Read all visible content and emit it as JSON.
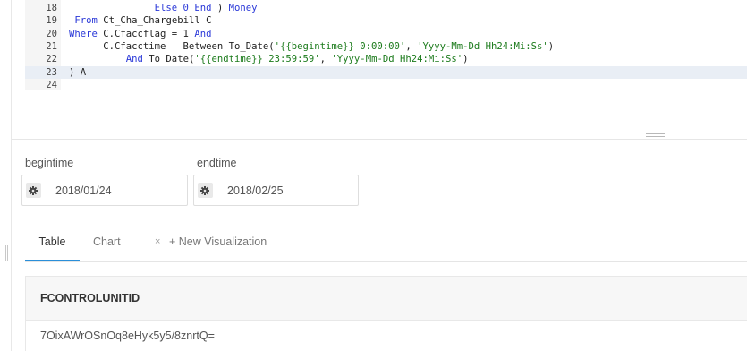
{
  "editor": {
    "lines": [
      {
        "num": "18",
        "active": false,
        "parts": [
          {
            "t": "               "
          },
          {
            "t": "Else 0 End",
            "c": "kw"
          },
          {
            "t": " ) "
          },
          {
            "t": "Money",
            "c": "kw"
          }
        ]
      },
      {
        "num": "19",
        "active": false,
        "parts": [
          {
            "t": " "
          },
          {
            "t": "From",
            "c": "kw"
          },
          {
            "t": " Ct_Cha_Chargebill C"
          }
        ]
      },
      {
        "num": "20",
        "active": false,
        "parts": [
          {
            "t": "Where",
            "c": "kw"
          },
          {
            "t": " C.Cfaccflag = 1 "
          },
          {
            "t": "And",
            "c": "kw"
          }
        ]
      },
      {
        "num": "21",
        "active": false,
        "parts": [
          {
            "t": "      C.Cfacctime   Between To_Date("
          },
          {
            "t": "'{{begintime}} 0:00:00'",
            "c": "str"
          },
          {
            "t": ", "
          },
          {
            "t": "'Yyyy-Mm-Dd Hh24:Mi:Ss'",
            "c": "str"
          },
          {
            "t": ")"
          }
        ]
      },
      {
        "num": "22",
        "active": false,
        "parts": [
          {
            "t": "          "
          },
          {
            "t": "And",
            "c": "kw"
          },
          {
            "t": " To_Date("
          },
          {
            "t": "'{{endtime}} 23:59:59'",
            "c": "str"
          },
          {
            "t": ", "
          },
          {
            "t": "'Yyyy-Mm-Dd Hh24:Mi:Ss'",
            "c": "str"
          },
          {
            "t": ")"
          }
        ]
      },
      {
        "num": "23",
        "active": true,
        "parts": [
          {
            "t": ") A"
          }
        ]
      },
      {
        "num": "24",
        "active": false,
        "parts": [
          {
            "t": ""
          }
        ]
      }
    ]
  },
  "params": {
    "begin": {
      "label": "begintime",
      "value": "2018/01/24"
    },
    "end": {
      "label": "endtime",
      "value": "2018/02/25"
    }
  },
  "tabs": {
    "table": "Table",
    "chart": "Chart",
    "chart_close": "×",
    "new_visualization": "+ New Visualization"
  },
  "results": {
    "columns": [
      "FCONTROLUNITID"
    ],
    "rows": [
      [
        "7OixAWrOSnOq8eHyk5y5/8znrtQ="
      ]
    ]
  },
  "icons": {
    "param_settings": "gear-icon"
  },
  "colors": {
    "keyword": "#2a38d8",
    "string": "#1c7b1c",
    "active_tab": "#2b8fd9",
    "active_line": "#e9eef5"
  }
}
